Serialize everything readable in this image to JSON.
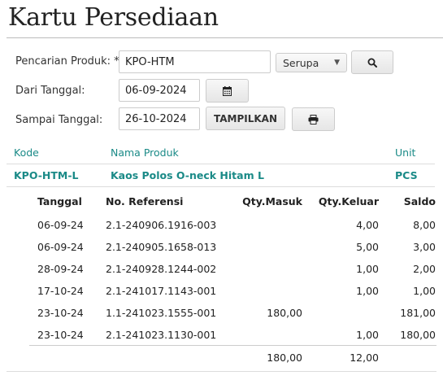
{
  "page": {
    "title": "Kartu Persediaan"
  },
  "form": {
    "product_label": "Pencarian Produk: *",
    "product_value": "KPO-HTM",
    "match_select": "Serupa",
    "from_label": "Dari Tanggal:",
    "from_value": "06-09-2024",
    "to_label": "Sampai Tanggal:",
    "to_value": "26-10-2024",
    "show_button": "TAMPILKAN"
  },
  "product": {
    "headers": {
      "code": "Kode",
      "name": "Nama Produk",
      "unit": "Unit"
    },
    "code": "KPO-HTM-L",
    "name": "Kaos Polos O-neck Hitam L",
    "unit": "PCS"
  },
  "table": {
    "headers": {
      "date": "Tanggal",
      "ref": "No. Referensi",
      "in": "Qty.Masuk",
      "out": "Qty.Keluar",
      "balance": "Saldo"
    },
    "rows": [
      {
        "date": "06-09-24",
        "ref": "2.1-240906.1916-003",
        "in": "",
        "out": "4,00",
        "balance": "8,00"
      },
      {
        "date": "06-09-24",
        "ref": "2.1-240905.1658-013",
        "in": "",
        "out": "5,00",
        "balance": "3,00"
      },
      {
        "date": "28-09-24",
        "ref": "2.1-240928.1244-002",
        "in": "",
        "out": "1,00",
        "balance": "2,00"
      },
      {
        "date": "17-10-24",
        "ref": "2.1-241017.1143-001",
        "in": "",
        "out": "1,00",
        "balance": "1,00"
      },
      {
        "date": "23-10-24",
        "ref": "1.1-241023.1555-001",
        "in": "180,00",
        "out": "",
        "balance": "181,00"
      },
      {
        "date": "23-10-24",
        "ref": "2.1-241023.1130-001",
        "in": "",
        "out": "1,00",
        "balance": "180,00"
      }
    ],
    "totals": {
      "in": "180,00",
      "out": "12,00"
    }
  },
  "icons": {
    "search": "search-icon",
    "calendar": "calendar-icon",
    "print": "print-icon",
    "dropdown": "caret-down-icon"
  },
  "colors": {
    "accent": "#1a8a87"
  }
}
